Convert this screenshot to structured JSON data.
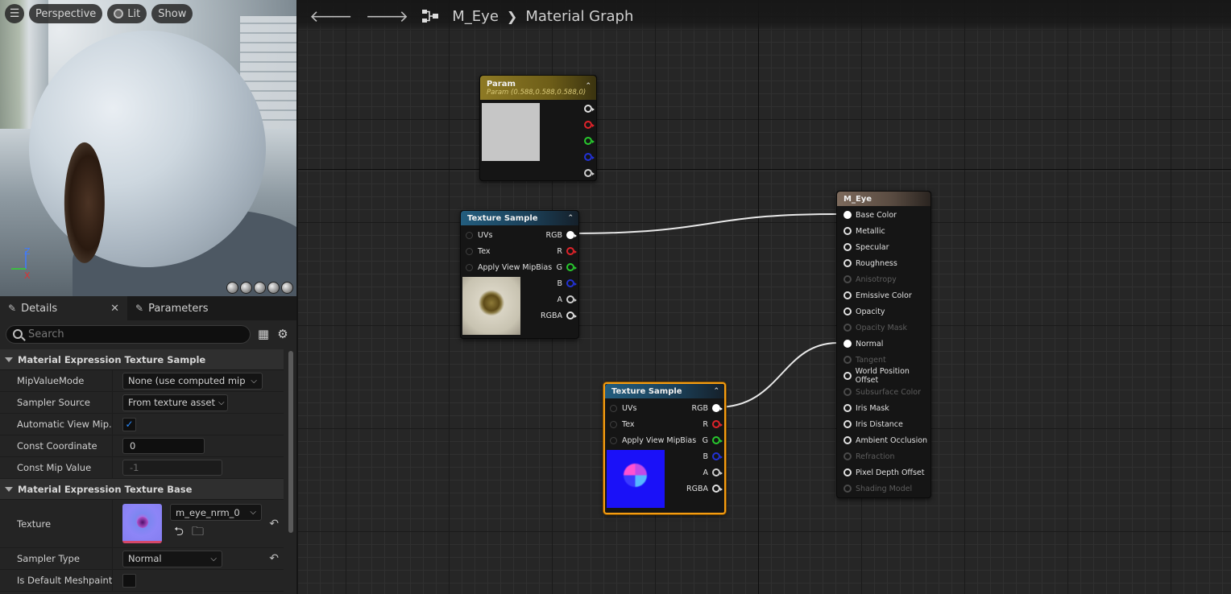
{
  "viewport": {
    "menu_icon": "hamburger-icon",
    "view_mode": "Perspective",
    "lighting": "Lit",
    "show": "Show",
    "axis_z": "Z",
    "axis_x": "X"
  },
  "details": {
    "tabs": [
      {
        "label": "Details",
        "icon": "pencil-icon"
      },
      {
        "label": "Parameters",
        "icon": "pencil-icon"
      }
    ],
    "search_placeholder": "Search",
    "categories": [
      {
        "title": "Material Expression Texture Sample"
      },
      {
        "title": "Material Expression Texture Base"
      }
    ],
    "rows": {
      "mip_value_mode": {
        "label": "MipValueMode",
        "value": "None (use computed mip le"
      },
      "sampler_source": {
        "label": "Sampler Source",
        "value": "From texture asset"
      },
      "auto_view_mip": {
        "label": "Automatic View Mip...",
        "checked": true
      },
      "const_coordinate": {
        "label": "Const Coordinate",
        "value": "0"
      },
      "const_mip_value": {
        "label": "Const Mip Value",
        "value": "-1"
      },
      "texture": {
        "label": "Texture",
        "value": "m_eye_nrm_0"
      },
      "sampler_type": {
        "label": "Sampler Type",
        "value": "Normal"
      },
      "default_meshpaint": {
        "label": "Is Default Meshpaint...",
        "checked": false
      }
    }
  },
  "graph": {
    "breadcrumb": {
      "asset": "M_Eye",
      "view": "Material Graph"
    },
    "param_node": {
      "title": "Param",
      "subtitle": "Param (0.588,0.588,0.588,0)",
      "swatch_color": "#c6c6c6"
    },
    "tex_node_1": {
      "title": "Texture Sample",
      "inputs": [
        "UVs",
        "Tex",
        "Apply View MipBias"
      ],
      "outputs": [
        "RGB",
        "R",
        "G",
        "B",
        "A",
        "RGBA"
      ]
    },
    "tex_node_2": {
      "title": "Texture Sample",
      "inputs": [
        "UVs",
        "Tex",
        "Apply View MipBias"
      ],
      "outputs": [
        "RGB",
        "R",
        "G",
        "B",
        "A",
        "RGBA"
      ]
    },
    "material_node": {
      "title": "M_Eye",
      "pins": [
        {
          "label": "Base Color",
          "enabled": true,
          "connected": true
        },
        {
          "label": "Metallic",
          "enabled": true,
          "connected": false
        },
        {
          "label": "Specular",
          "enabled": true,
          "connected": false
        },
        {
          "label": "Roughness",
          "enabled": true,
          "connected": false
        },
        {
          "label": "Anisotropy",
          "enabled": false,
          "connected": false
        },
        {
          "label": "Emissive Color",
          "enabled": true,
          "connected": false
        },
        {
          "label": "Opacity",
          "enabled": true,
          "connected": false
        },
        {
          "label": "Opacity Mask",
          "enabled": false,
          "connected": false
        },
        {
          "label": "Normal",
          "enabled": true,
          "connected": true
        },
        {
          "label": "Tangent",
          "enabled": false,
          "connected": false
        },
        {
          "label": "World Position Offset",
          "enabled": true,
          "connected": false
        },
        {
          "label": "Subsurface Color",
          "enabled": false,
          "connected": false
        },
        {
          "label": "Iris Mask",
          "enabled": true,
          "connected": false
        },
        {
          "label": "Iris Distance",
          "enabled": true,
          "connected": false
        },
        {
          "label": "Ambient Occlusion",
          "enabled": true,
          "connected": false
        },
        {
          "label": "Refraction",
          "enabled": false,
          "connected": false
        },
        {
          "label": "Pixel Depth Offset",
          "enabled": true,
          "connected": false
        },
        {
          "label": "Shading Model",
          "enabled": false,
          "connected": false
        }
      ]
    }
  }
}
